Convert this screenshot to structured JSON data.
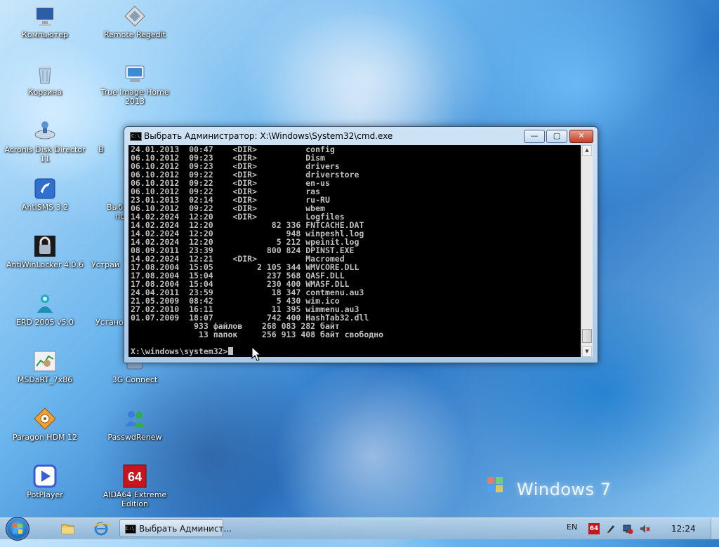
{
  "desktop": {
    "icons": [
      {
        "label": "Компьютер"
      },
      {
        "label": "Remote Regedit"
      },
      {
        "label": "Корзина"
      },
      {
        "label": "True Image Home 2013"
      },
      {
        "label": "Acronis Disk Director 11"
      },
      {
        "label": "AntiSMS 3.2"
      },
      {
        "label": "AntiWinLocker 4.0.6"
      },
      {
        "label": "ERD 2005 v5.0"
      },
      {
        "label": "MSDaRT_7x86"
      },
      {
        "label": "3G Connect"
      },
      {
        "label": "Paragon HDM 12"
      },
      {
        "label": "PasswdRenew"
      },
      {
        "label": "PotPlayer"
      },
      {
        "label": "AIDA64 Extreme Edition"
      }
    ],
    "partial_labels": [
      "В",
      "Выб",
      "по",
      "Устрай",
      "Устано"
    ],
    "watermark": "Windows 7"
  },
  "cmd": {
    "title": "Выбрать Администратор: X:\\Windows\\System32\\cmd.exe",
    "icon_text": "C:\\",
    "buttons": {
      "minimize": "—",
      "maximize": "▢",
      "close": "✕"
    },
    "lines": [
      "24.01.2013  00:47    <DIR>          config",
      "06.10.2012  09:23    <DIR>          Dism",
      "06.10.2012  09:23    <DIR>          drivers",
      "06.10.2012  09:22    <DIR>          driverstore",
      "06.10.2012  09:22    <DIR>          en-us",
      "06.10.2012  09:22    <DIR>          ras",
      "23.01.2013  02:14    <DIR>          ru-RU",
      "06.10.2012  09:22    <DIR>          wbem",
      "14.02.2024  12:20    <DIR>          Logfiles",
      "14.02.2024  12:20            82 336 FNTCACHE.DAT",
      "14.02.2024  12:20               948 winpeshl.log",
      "14.02.2024  12:20             5 212 wpeinit.log",
      "08.09.2011  23:39           800 824 DPINST.EXE",
      "14.02.2024  12:21    <DIR>          Macromed",
      "17.08.2004  15:05         2 105 344 WMVCORE.DLL",
      "17.08.2004  15:04           237 568 QASF.DLL",
      "17.08.2004  15:04           230 400 WMASF.DLL",
      "24.04.2011  23:59            18 347 contmenu.au3",
      "21.05.2009  08:42             5 430 wim.ico",
      "27.02.2010  16:11            11 395 wimmenu.au3",
      "01.07.2009  18:07           742 400 HashTab32.dll",
      "             933 файлов    268 083 282 байт",
      "              13 папок     256 913 408 байт свободно"
    ],
    "prompt": "X:\\windows\\system32>"
  },
  "taskbar": {
    "task_label": "Выбрать Админист...",
    "language": "EN",
    "tray_badge": "64",
    "clock": "12:24"
  },
  "colors": {
    "cmd_background": "#000000",
    "cmd_text": "#c0c0c0",
    "titlebar": "#cfe3f5",
    "close_button": "#c23e28"
  }
}
